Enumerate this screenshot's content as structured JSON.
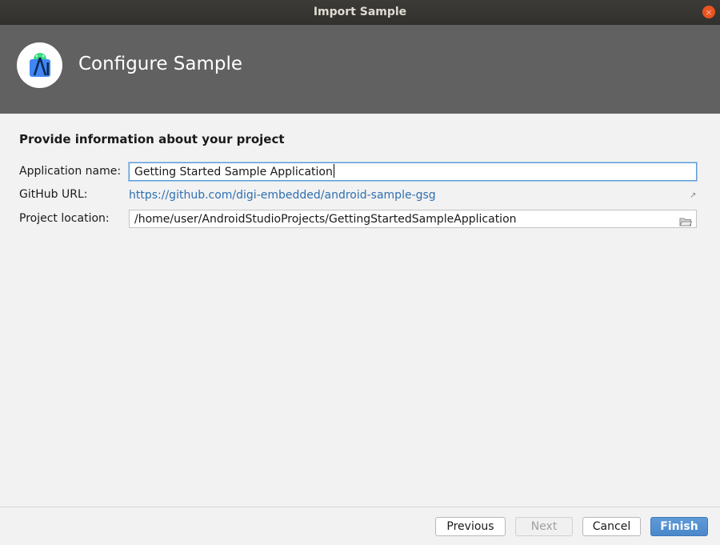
{
  "window": {
    "title": "Import Sample",
    "close_glyph": "×"
  },
  "header": {
    "title": "Configure Sample",
    "logo_icon": "android-studio-icon"
  },
  "form": {
    "heading": "Provide information about your project",
    "app_name_label": "Application name:",
    "app_name_value": "Getting Started Sample Application",
    "github_label": "GitHub URL:",
    "github_url": "https://github.com/digi-embedded/android-sample-gsg",
    "external_link_glyph": "↗",
    "location_label": "Project location:",
    "location_value": "/home/user/AndroidStudioProjects/GettingStartedSampleApplication"
  },
  "footer": {
    "previous_label": "Previous",
    "next_label": "Next",
    "cancel_label": "Cancel",
    "finish_label": "Finish"
  },
  "colors": {
    "header_bg": "#616161",
    "link": "#2f6fb1",
    "primary_button": "#4a88cb",
    "close_button": "#e95420"
  }
}
